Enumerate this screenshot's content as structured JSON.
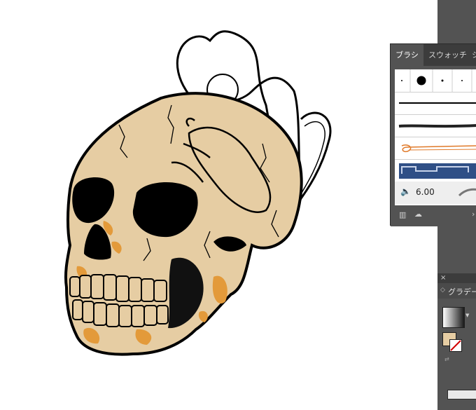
{
  "brush_panel": {
    "tabs": [
      "ブラシ",
      "スウォッチ",
      "シ"
    ],
    "stroke_weight": "6.00"
  },
  "gradient_panel": {
    "close_glyph": "×",
    "title": "グラデー"
  },
  "colors": {
    "skull_fill": "#e6cda3",
    "outline": "#000000",
    "orange_accent": "#e39a3a",
    "panel_bg": "#535353",
    "tab_bar": "#3c3c3c"
  },
  "icons": [
    "speaker-icon",
    "library-icon",
    "cloud-icon",
    "arrow-right-icon",
    "gradient-swatch-icon",
    "fill-stroke-icon"
  ]
}
